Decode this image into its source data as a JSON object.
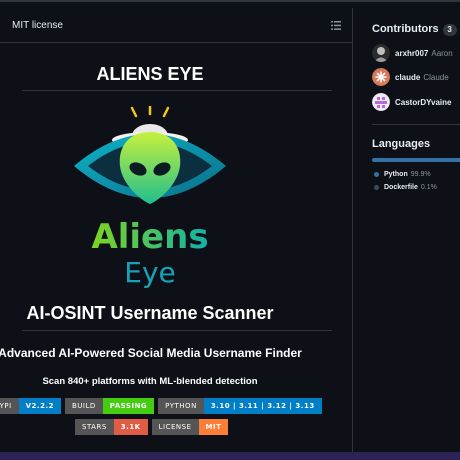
{
  "readme": {
    "header_title": "MIT license",
    "title": "ALIENS EYE",
    "logo": {
      "word1": "Aliens",
      "word2": "Eye"
    },
    "subtitle": "AI-OSINT Username Scanner",
    "tagline": "Advanced AI-Powered Social Media Username Finder",
    "scan": "Scan 840+ platforms with ML-blended detection",
    "badges_row1": [
      {
        "label": "PYPI",
        "value": "V2.2.2",
        "color": "#007ec6"
      },
      {
        "label": "BUILD",
        "value": "PASSING",
        "color": "#4c1"
      },
      {
        "label": "PYTHON",
        "value": "3.10 | 3.11 | 3.12 | 3.13",
        "color": "#007ec6"
      }
    ],
    "badges_row2": [
      {
        "label": "STARS",
        "value": "3.1K",
        "color": "#e05d44"
      },
      {
        "label": "LICENSE",
        "value": "MIT",
        "color": "#fe7d37"
      }
    ]
  },
  "sidebar": {
    "contributors_title": "Contributors",
    "contributors_count": "3",
    "contributors": [
      {
        "login": "arxhr007",
        "name": "Aaron"
      },
      {
        "login": "claude",
        "name": "Claude"
      },
      {
        "login": "CastorDYvaine",
        "name": ""
      }
    ],
    "languages_title": "Languages",
    "languages": [
      {
        "name": "Python",
        "percent": "99.9%",
        "color": "#3572A5"
      },
      {
        "name": "Dockerfile",
        "percent": "0.1%",
        "color": "#384d54"
      }
    ]
  }
}
